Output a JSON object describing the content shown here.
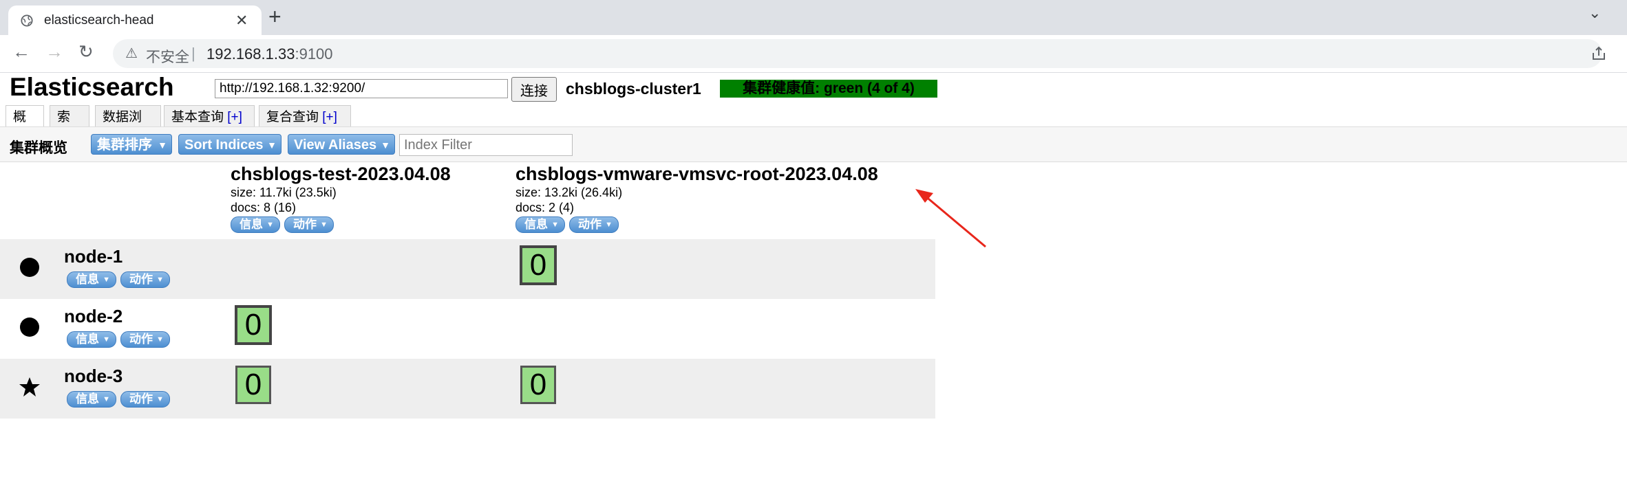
{
  "browser": {
    "tab_title": "elasticsearch-head",
    "tab_close": "✕",
    "new_tab": "+",
    "tab_menu": "⌄",
    "back": "←",
    "forward": "→",
    "reload": "↻",
    "insecure_label": "不安全",
    "separator": "|",
    "url_host": "192.168.1.33",
    "url_port": ":9100"
  },
  "app": {
    "title": "Elasticsearch",
    "connect_url": "http://192.168.1.32:9200/",
    "connect_button": "连接",
    "cluster_name": "chsblogs-cluster1",
    "health_text": "集群健康值: green (4 of 4)",
    "health_color": "#008000"
  },
  "tabs": [
    {
      "label": "概览",
      "plus": ""
    },
    {
      "label": "索引",
      "plus": ""
    },
    {
      "label": "数据浏览",
      "plus": ""
    },
    {
      "label": "基本查询 ",
      "plus": "[+]"
    },
    {
      "label": "复合查询 ",
      "plus": "[+]"
    }
  ],
  "toolbar": {
    "title": "集群概览",
    "sort_cluster": "集群排序",
    "sort_indices": "Sort Indices",
    "view_aliases": "View Aliases",
    "filter_placeholder": "Index Filter"
  },
  "pill_labels": {
    "info": "信息",
    "action": "动作"
  },
  "indices": [
    {
      "name": "chsblogs-test-2023.04.08",
      "size": "size: 11.7ki (23.5ki)",
      "docs": "docs: 8 (16)"
    },
    {
      "name": "chsblogs-vmware-vmsvc-root-2023.04.08",
      "size": "size: 13.2ki (26.4ki)",
      "docs": "docs: 2 (4)"
    }
  ],
  "nodes": [
    {
      "name": "node-1",
      "icon": "circle-icon",
      "shards": [
        "",
        "0"
      ]
    },
    {
      "name": "node-2",
      "icon": "circle-icon",
      "shards": [
        "0",
        ""
      ]
    },
    {
      "name": "node-3",
      "icon": "star-icon",
      "shards": [
        "0",
        "0"
      ]
    }
  ],
  "colors": {
    "shard_fill": "#99dd88",
    "button_blue": "#4d8fd1",
    "annotation_arrow": "#e8261b"
  }
}
